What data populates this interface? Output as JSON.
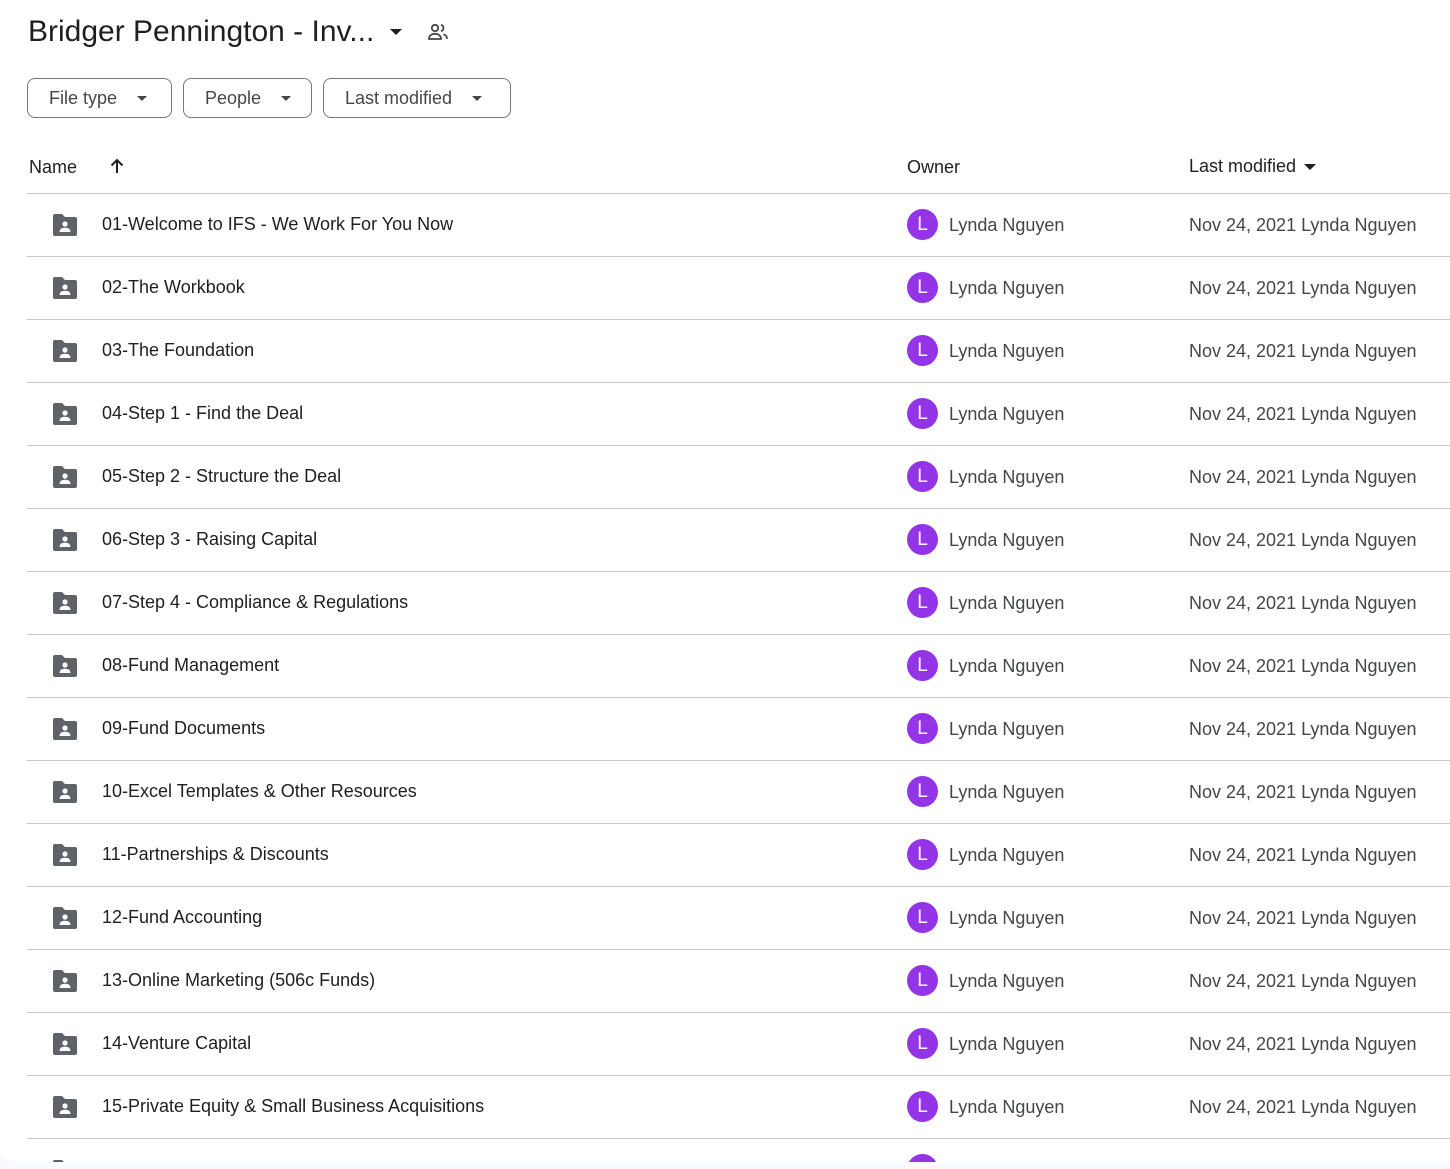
{
  "header": {
    "title": "Bridger Pennington - Inv...",
    "title_dropdown_icon": "arrow-drop-down-icon",
    "shared_icon": "people-outline-icon"
  },
  "filters": {
    "file_type": "File type",
    "people": "People",
    "last_modified": "Last modified"
  },
  "columns": {
    "name": "Name",
    "name_sort_icon": "arrow-upward-icon",
    "owner": "Owner",
    "last_modified": "Last modified",
    "last_modified_icon": "arrow-drop-down-icon"
  },
  "rows": [
    {
      "name": "01-Welcome to IFS - We Work For You Now",
      "avatar": "L",
      "owner": "Lynda Nguyen",
      "modified": "Nov 24, 2021 Lynda Nguyen"
    },
    {
      "name": "02-The Workbook",
      "avatar": "L",
      "owner": "Lynda Nguyen",
      "modified": "Nov 24, 2021 Lynda Nguyen"
    },
    {
      "name": "03-The Foundation",
      "avatar": "L",
      "owner": "Lynda Nguyen",
      "modified": "Nov 24, 2021 Lynda Nguyen"
    },
    {
      "name": "04-Step 1 - Find the Deal",
      "avatar": "L",
      "owner": "Lynda Nguyen",
      "modified": "Nov 24, 2021 Lynda Nguyen"
    },
    {
      "name": "05-Step 2 - Structure the Deal",
      "avatar": "L",
      "owner": "Lynda Nguyen",
      "modified": "Nov 24, 2021 Lynda Nguyen"
    },
    {
      "name": "06-Step 3 - Raising Capital",
      "avatar": "L",
      "owner": "Lynda Nguyen",
      "modified": "Nov 24, 2021 Lynda Nguyen"
    },
    {
      "name": "07-Step 4 - Compliance & Regulations",
      "avatar": "L",
      "owner": "Lynda Nguyen",
      "modified": "Nov 24, 2021 Lynda Nguyen"
    },
    {
      "name": "08-Fund Management",
      "avatar": "L",
      "owner": "Lynda Nguyen",
      "modified": "Nov 24, 2021 Lynda Nguyen"
    },
    {
      "name": "09-Fund Documents",
      "avatar": "L",
      "owner": "Lynda Nguyen",
      "modified": "Nov 24, 2021 Lynda Nguyen"
    },
    {
      "name": "10-Excel Templates & Other Resources",
      "avatar": "L",
      "owner": "Lynda Nguyen",
      "modified": "Nov 24, 2021 Lynda Nguyen"
    },
    {
      "name": "11-Partnerships & Discounts",
      "avatar": "L",
      "owner": "Lynda Nguyen",
      "modified": "Nov 24, 2021 Lynda Nguyen"
    },
    {
      "name": "12-Fund Accounting",
      "avatar": "L",
      "owner": "Lynda Nguyen",
      "modified": "Nov 24, 2021 Lynda Nguyen"
    },
    {
      "name": "13-Online Marketing (506c Funds)",
      "avatar": "L",
      "owner": "Lynda Nguyen",
      "modified": "Nov 24, 2021 Lynda Nguyen"
    },
    {
      "name": "14-Venture Capital",
      "avatar": "L",
      "owner": "Lynda Nguyen",
      "modified": "Nov 24, 2021 Lynda Nguyen"
    },
    {
      "name": "15-Private Equity & Small Business Acquisitions",
      "avatar": "L",
      "owner": "Lynda Nguyen",
      "modified": "Nov 24, 2021 Lynda Nguyen"
    },
    {
      "name": "",
      "avatar": "",
      "owner": "",
      "modified": ""
    }
  ],
  "colors": {
    "avatar_bg": "#9334e6",
    "folder_icon": "#5f6368",
    "divider": "#c7c7c7"
  }
}
